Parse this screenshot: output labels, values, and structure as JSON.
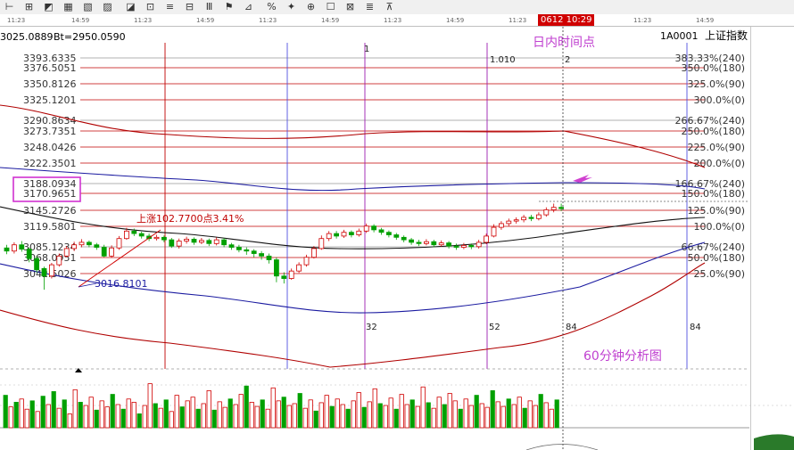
{
  "toolbar": {
    "icons": [
      "marker-icon",
      "cross-icon",
      "line-icon",
      "grid-icon",
      "ray-icon",
      "channel-icon",
      "parallel-icon",
      "fan-icon",
      "text-icon",
      "arc-icon",
      "fib-icon",
      "box-icon",
      "circle-icon",
      "percent-icon",
      "gann-icon",
      "period-icon",
      "angle-icon",
      "arrow-icon",
      "up-arrow-icon",
      "down-arrow-icon"
    ]
  },
  "time_axis": {
    "labels": [
      "11:23",
      "14:59",
      "11:23",
      "14:59",
      "11:23",
      "14:59",
      "11:23",
      "14:59",
      "11:23"
    ],
    "cursor_time": "0612 10:29",
    "end_labels": [
      "11:23",
      "14:59"
    ]
  },
  "header": {
    "left_value": "3025.0889",
    "bt_value": "Bt=2950.0590",
    "code": "1A0001",
    "index_name": "上证指数"
  },
  "price_labels": [
    "3393.6335",
    "3376.5051",
    "3350.8126",
    "3325.1201",
    "3290.8634",
    "3273.7351",
    "3248.0426",
    "3222.3501",
    "3188.0934",
    "3170.9651",
    "3145.2726",
    "3119.5801",
    "3085.1234",
    "3068.0951",
    "3042.5026"
  ],
  "percent_labels": [
    "383.33%(240)",
    "350.0%(180)",
    "325.0%(90)",
    "300.0%(0)",
    "266.67%(240)",
    "250.0%(180)",
    "225.0%(90)",
    "200.0%(0)",
    "166.67%(240)",
    "150.0%(180)",
    "125.0%(90)",
    "100.0%(0)",
    "66.67%(240)",
    "50.0%(180)",
    "25.0%(90)"
  ],
  "cycle_labels": [
    "1",
    "1.010",
    "2",
    "32",
    "52",
    "84",
    "84"
  ],
  "annotations": {
    "intraday_point": "日内时间点",
    "rise": "上涨102.7700点3.41%",
    "low": "3016.8101",
    "chart_caption": "60分钟分析图"
  },
  "colors": {
    "candle_up": "#d00000",
    "candle_down": "#00a000",
    "fib_line": "#c00000",
    "cycle_line": "#9b1cb0",
    "annotation": "#c041d0",
    "highlight_box": "#d032d0"
  },
  "volumes": [
    {
      "v": 0.7,
      "up": false
    },
    {
      "v": 0.45,
      "up": true
    },
    {
      "v": 0.55,
      "up": false
    },
    {
      "v": 0.62,
      "up": true
    },
    {
      "v": 0.4,
      "up": true
    },
    {
      "v": 0.58,
      "up": false
    },
    {
      "v": 0.35,
      "up": true
    },
    {
      "v": 0.68,
      "up": false
    },
    {
      "v": 0.5,
      "up": true
    },
    {
      "v": 0.78,
      "up": false
    },
    {
      "v": 0.42,
      "up": true
    },
    {
      "v": 0.6,
      "up": false
    },
    {
      "v": 0.3,
      "up": true
    },
    {
      "v": 0.82,
      "up": true
    },
    {
      "v": 0.55,
      "up": false
    },
    {
      "v": 0.48,
      "up": true
    },
    {
      "v": 0.66,
      "up": true
    },
    {
      "v": 0.38,
      "up": false
    },
    {
      "v": 0.58,
      "up": true
    },
    {
      "v": 0.45,
      "up": true
    },
    {
      "v": 0.72,
      "up": false
    },
    {
      "v": 0.5,
      "up": true
    },
    {
      "v": 0.4,
      "up": false
    },
    {
      "v": 0.62,
      "up": true
    },
    {
      "v": 0.55,
      "up": true
    },
    {
      "v": 0.3,
      "up": false
    },
    {
      "v": 0.48,
      "up": true
    },
    {
      "v": 0.95,
      "up": true
    },
    {
      "v": 0.52,
      "up": false
    },
    {
      "v": 0.42,
      "up": true
    },
    {
      "v": 0.6,
      "up": false
    },
    {
      "v": 0.35,
      "up": true
    },
    {
      "v": 0.7,
      "up": true
    },
    {
      "v": 0.45,
      "up": false
    },
    {
      "v": 0.58,
      "up": true
    },
    {
      "v": 0.66,
      "up": true
    },
    {
      "v": 0.4,
      "up": false
    },
    {
      "v": 0.52,
      "up": true
    },
    {
      "v": 0.8,
      "up": true
    },
    {
      "v": 0.38,
      "up": false
    },
    {
      "v": 0.56,
      "up": true
    },
    {
      "v": 0.44,
      "up": true
    },
    {
      "v": 0.62,
      "up": false
    },
    {
      "v": 0.5,
      "up": true
    },
    {
      "v": 0.72,
      "up": true
    },
    {
      "v": 0.9,
      "up": false
    },
    {
      "v": 0.55,
      "up": true
    },
    {
      "v": 0.46,
      "up": true
    },
    {
      "v": 0.6,
      "up": false
    },
    {
      "v": 0.4,
      "up": true
    },
    {
      "v": 0.86,
      "up": true
    },
    {
      "v": 0.58,
      "up": true
    },
    {
      "v": 0.66,
      "up": false
    },
    {
      "v": 0.48,
      "up": true
    },
    {
      "v": 0.52,
      "up": true
    },
    {
      "v": 0.74,
      "up": false
    },
    {
      "v": 0.42,
      "up": true
    },
    {
      "v": 0.6,
      "up": true
    },
    {
      "v": 0.36,
      "up": false
    },
    {
      "v": 0.54,
      "up": true
    },
    {
      "v": 0.7,
      "up": true
    },
    {
      "v": 0.46,
      "up": false
    },
    {
      "v": 0.62,
      "up": true
    },
    {
      "v": 0.5,
      "up": true
    },
    {
      "v": 0.4,
      "up": false
    },
    {
      "v": 0.58,
      "up": true
    },
    {
      "v": 0.76,
      "up": true
    },
    {
      "v": 0.44,
      "up": false
    },
    {
      "v": 0.56,
      "up": true
    },
    {
      "v": 0.84,
      "up": true
    },
    {
      "v": 0.52,
      "up": false
    },
    {
      "v": 0.48,
      "up": true
    },
    {
      "v": 0.64,
      "up": true
    },
    {
      "v": 0.4,
      "up": false
    },
    {
      "v": 0.72,
      "up": true
    },
    {
      "v": 0.5,
      "up": true
    },
    {
      "v": 0.6,
      "up": false
    },
    {
      "v": 0.46,
      "up": true
    },
    {
      "v": 0.88,
      "up": true
    },
    {
      "v": 0.54,
      "up": false
    },
    {
      "v": 0.42,
      "up": true
    },
    {
      "v": 0.66,
      "up": true
    },
    {
      "v": 0.5,
      "up": false
    },
    {
      "v": 0.74,
      "up": true
    },
    {
      "v": 0.58,
      "up": true
    },
    {
      "v": 0.4,
      "up": false
    },
    {
      "v": 0.62,
      "up": true
    },
    {
      "v": 0.48,
      "up": true
    },
    {
      "v": 0.7,
      "up": false
    },
    {
      "v": 0.52,
      "up": true
    },
    {
      "v": 0.44,
      "up": true
    },
    {
      "v": 0.8,
      "up": false
    },
    {
      "v": 0.56,
      "up": true
    },
    {
      "v": 0.46,
      "up": true
    },
    {
      "v": 0.62,
      "up": false
    },
    {
      "v": 0.5,
      "up": true
    },
    {
      "v": 0.66,
      "up": true
    },
    {
      "v": 0.42,
      "up": false
    },
    {
      "v": 0.58,
      "up": true
    },
    {
      "v": 0.48,
      "up": true
    },
    {
      "v": 0.72,
      "up": false
    },
    {
      "v": 0.54,
      "up": true
    },
    {
      "v": 0.4,
      "up": true
    },
    {
      "v": 0.6,
      "up": false
    }
  ],
  "candles": [
    {
      "o": 3085,
      "c": 3080,
      "h": 3090,
      "l": 3075
    },
    {
      "o": 3080,
      "c": 3090,
      "h": 3094,
      "l": 3076
    },
    {
      "o": 3090,
      "c": 3083,
      "h": 3096,
      "l": 3079
    },
    {
      "o": 3083,
      "c": 3068,
      "h": 3086,
      "l": 3062
    },
    {
      "o": 3068,
      "c": 3050,
      "h": 3072,
      "l": 3045
    },
    {
      "o": 3052,
      "c": 3040,
      "h": 3055,
      "l": 3018
    },
    {
      "o": 3040,
      "c": 3058,
      "h": 3061,
      "l": 3036
    },
    {
      "o": 3058,
      "c": 3072,
      "h": 3076,
      "l": 3055
    },
    {
      "o": 3072,
      "c": 3084,
      "h": 3088,
      "l": 3070
    },
    {
      "o": 3084,
      "c": 3090,
      "h": 3095,
      "l": 3080
    },
    {
      "o": 3090,
      "c": 3094,
      "h": 3099,
      "l": 3086
    },
    {
      "o": 3094,
      "c": 3090,
      "h": 3097,
      "l": 3086
    },
    {
      "o": 3090,
      "c": 3086,
      "h": 3093,
      "l": 3082
    },
    {
      "o": 3086,
      "c": 3072,
      "h": 3090,
      "l": 3070
    },
    {
      "o": 3072,
      "c": 3085,
      "h": 3089,
      "l": 3069
    },
    {
      "o": 3085,
      "c": 3100,
      "h": 3104,
      "l": 3082
    },
    {
      "o": 3100,
      "c": 3112,
      "h": 3117,
      "l": 3098
    },
    {
      "o": 3112,
      "c": 3108,
      "h": 3116,
      "l": 3104
    },
    {
      "o": 3108,
      "c": 3104,
      "h": 3111,
      "l": 3100
    },
    {
      "o": 3104,
      "c": 3100,
      "h": 3108,
      "l": 3096
    },
    {
      "o": 3100,
      "c": 3102,
      "h": 3106,
      "l": 3097
    },
    {
      "o": 3102,
      "c": 3098,
      "h": 3105,
      "l": 3094
    },
    {
      "o": 3098,
      "c": 3088,
      "h": 3101,
      "l": 3085
    },
    {
      "o": 3088,
      "c": 3096,
      "h": 3100,
      "l": 3084
    },
    {
      "o": 3096,
      "c": 3099,
      "h": 3103,
      "l": 3092
    },
    {
      "o": 3099,
      "c": 3094,
      "h": 3102,
      "l": 3090
    },
    {
      "o": 3094,
      "c": 3097,
      "h": 3101,
      "l": 3091
    },
    {
      "o": 3097,
      "c": 3092,
      "h": 3100,
      "l": 3088
    },
    {
      "o": 3092,
      "c": 3098,
      "h": 3102,
      "l": 3089
    },
    {
      "o": 3098,
      "c": 3090,
      "h": 3101,
      "l": 3086
    },
    {
      "o": 3090,
      "c": 3086,
      "h": 3093,
      "l": 3082
    },
    {
      "o": 3086,
      "c": 3082,
      "h": 3090,
      "l": 3078
    },
    {
      "o": 3082,
      "c": 3080,
      "h": 3086,
      "l": 3074
    },
    {
      "o": 3080,
      "c": 3076,
      "h": 3083,
      "l": 3070
    },
    {
      "o": 3076,
      "c": 3072,
      "h": 3080,
      "l": 3066
    },
    {
      "o": 3072,
      "c": 3066,
      "h": 3076,
      "l": 3060
    },
    {
      "o": 3066,
      "c": 3040,
      "h": 3070,
      "l": 3030
    },
    {
      "o": 3040,
      "c": 3036,
      "h": 3046,
      "l": 3028
    },
    {
      "o": 3036,
      "c": 3048,
      "h": 3052,
      "l": 3034
    },
    {
      "o": 3048,
      "c": 3058,
      "h": 3062,
      "l": 3045
    },
    {
      "o": 3058,
      "c": 3070,
      "h": 3074,
      "l": 3055
    },
    {
      "o": 3070,
      "c": 3084,
      "h": 3088,
      "l": 3068
    },
    {
      "o": 3084,
      "c": 3100,
      "h": 3105,
      "l": 3082
    },
    {
      "o": 3100,
      "c": 3108,
      "h": 3112,
      "l": 3096
    },
    {
      "o": 3108,
      "c": 3104,
      "h": 3112,
      "l": 3100
    },
    {
      "o": 3104,
      "c": 3110,
      "h": 3114,
      "l": 3101
    },
    {
      "o": 3110,
      "c": 3106,
      "h": 3113,
      "l": 3102
    },
    {
      "o": 3106,
      "c": 3112,
      "h": 3116,
      "l": 3103
    },
    {
      "o": 3112,
      "c": 3120,
      "h": 3124,
      "l": 3109
    },
    {
      "o": 3120,
      "c": 3114,
      "h": 3123,
      "l": 3110
    },
    {
      "o": 3114,
      "c": 3110,
      "h": 3117,
      "l": 3106
    },
    {
      "o": 3110,
      "c": 3106,
      "h": 3113,
      "l": 3102
    },
    {
      "o": 3106,
      "c": 3102,
      "h": 3109,
      "l": 3098
    },
    {
      "o": 3102,
      "c": 3098,
      "h": 3105,
      "l": 3094
    },
    {
      "o": 3098,
      "c": 3094,
      "h": 3101,
      "l": 3090
    },
    {
      "o": 3094,
      "c": 3092,
      "h": 3098,
      "l": 3088
    },
    {
      "o": 3092,
      "c": 3095,
      "h": 3099,
      "l": 3089
    },
    {
      "o": 3095,
      "c": 3090,
      "h": 3098,
      "l": 3086
    },
    {
      "o": 3090,
      "c": 3093,
      "h": 3097,
      "l": 3087
    },
    {
      "o": 3093,
      "c": 3088,
      "h": 3096,
      "l": 3084
    },
    {
      "o": 3088,
      "c": 3086,
      "h": 3092,
      "l": 3082
    },
    {
      "o": 3086,
      "c": 3089,
      "h": 3093,
      "l": 3083
    },
    {
      "o": 3089,
      "c": 3087,
      "h": 3092,
      "l": 3083
    },
    {
      "o": 3087,
      "c": 3094,
      "h": 3098,
      "l": 3084
    },
    {
      "o": 3094,
      "c": 3104,
      "h": 3108,
      "l": 3091
    },
    {
      "o": 3104,
      "c": 3118,
      "h": 3123,
      "l": 3102
    },
    {
      "o": 3118,
      "c": 3124,
      "h": 3128,
      "l": 3114
    },
    {
      "o": 3124,
      "c": 3128,
      "h": 3132,
      "l": 3120
    },
    {
      "o": 3128,
      "c": 3130,
      "h": 3134,
      "l": 3124
    },
    {
      "o": 3130,
      "c": 3134,
      "h": 3138,
      "l": 3126
    },
    {
      "o": 3134,
      "c": 3132,
      "h": 3138,
      "l": 3128
    },
    {
      "o": 3132,
      "c": 3138,
      "h": 3142,
      "l": 3129
    },
    {
      "o": 3138,
      "c": 3146,
      "h": 3150,
      "l": 3135
    },
    {
      "o": 3146,
      "c": 3150,
      "h": 3156,
      "l": 3142
    },
    {
      "o": 3150,
      "c": 3148,
      "h": 3156,
      "l": 3144
    }
  ]
}
